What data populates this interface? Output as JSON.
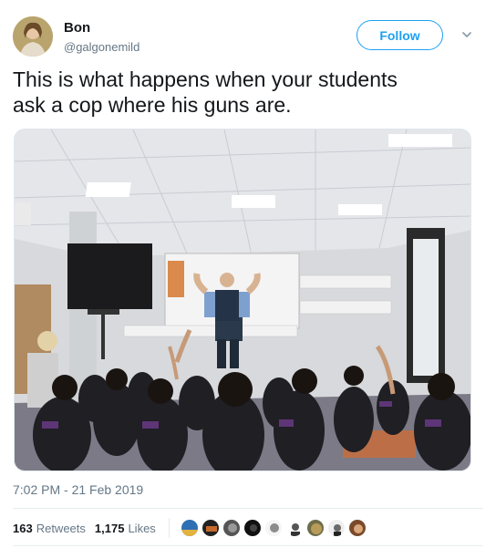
{
  "author": {
    "display_name": "Bon",
    "handle": "@galgonemild",
    "avatar_icon": "user-avatar-photo"
  },
  "follow_button": {
    "label": "Follow",
    "color": "#1da1f2"
  },
  "menu": {
    "icon": "chevron-down-icon"
  },
  "tweet": {
    "text_line1": "This is what happens when your students",
    "text_line2": "ask a cop where his guns are."
  },
  "media": {
    "icon": "classroom-photo"
  },
  "meta": {
    "timestamp": "7:02 PM - 21 Feb 2019"
  },
  "engagement": {
    "retweets_count": "163",
    "retweets_label": "Retweets",
    "likes_count": "1,175",
    "likes_label": "Likes",
    "likers": [
      {
        "icon": "liker-avatar-1",
        "color": "#2f6fb3"
      },
      {
        "icon": "liker-avatar-2",
        "color": "#222222"
      },
      {
        "icon": "liker-avatar-3",
        "color": "#555555"
      },
      {
        "icon": "liker-avatar-4",
        "color": "#111111"
      },
      {
        "icon": "liker-avatar-5",
        "color": "#8c8c8c"
      },
      {
        "icon": "liker-avatar-6",
        "color": "#bdbdbd"
      },
      {
        "icon": "liker-avatar-7",
        "color": "#6d6d4a"
      },
      {
        "icon": "liker-avatar-8",
        "color": "#9a9a9a"
      },
      {
        "icon": "liker-avatar-9",
        "color": "#7a4a2a"
      }
    ]
  }
}
